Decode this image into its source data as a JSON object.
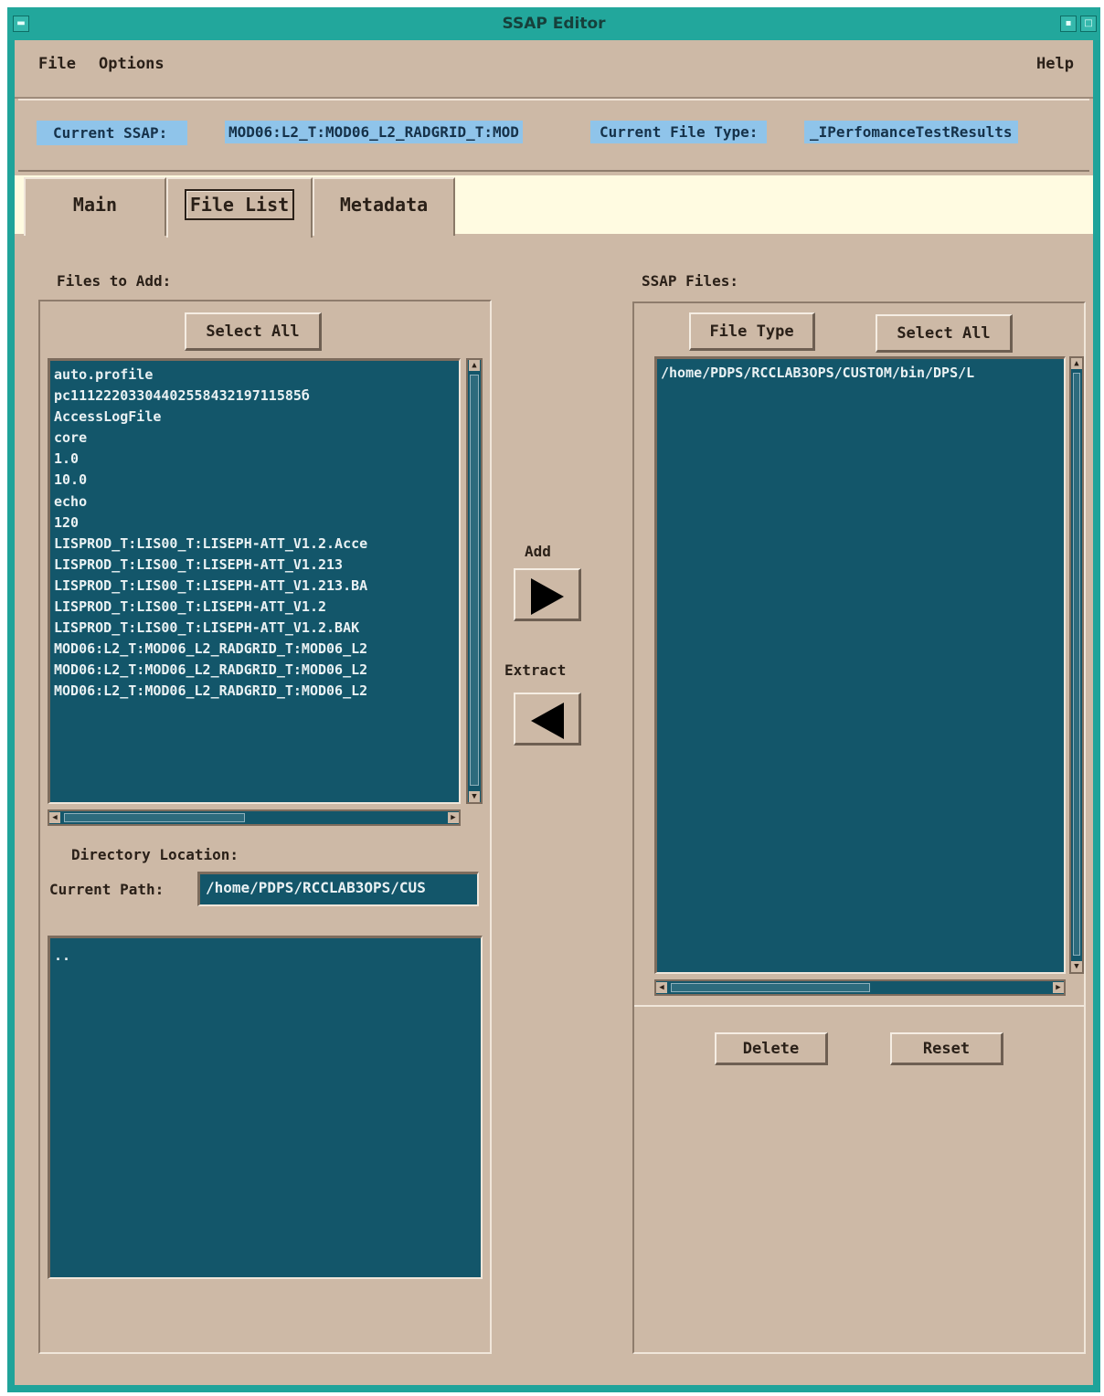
{
  "window": {
    "title": "SSAP Editor"
  },
  "menu": {
    "file": "File",
    "options": "Options",
    "help": "Help"
  },
  "ssap": {
    "current_ssap_label": "Current SSAP:",
    "current_ssap_value": "MOD06:L2_T:MOD06_L2_RADGRID_T:MOD",
    "file_type_label": "Current File Type:",
    "file_type_value": "_IPerfomanceTestResults"
  },
  "tabs": [
    {
      "label": "Main"
    },
    {
      "label": "File List"
    },
    {
      "label": "Metadata"
    }
  ],
  "left": {
    "files_to_add_label": "Files to Add:",
    "select_all": "Select All",
    "files": [
      "auto.profile",
      "pc1112220330440255843219711585б",
      "AccessLogFile",
      "core",
      "1.0",
      "10.0",
      "echo",
      "120",
      "LISPROD_T:LIS00_T:LISEPH-ATT_V1.2.Acce",
      "LISPROD_T:LIS00_T:LISEPH-ATT_V1.213",
      "LISPROD_T:LIS00_T:LISEPH-ATT_V1.213.BA",
      "LISPROD_T:LIS00_T:LISEPH-ATT_V1.2",
      "LISPROD_T:LIS00_T:LISEPH-ATT_V1.2.BAK",
      "MOD06:L2_T:MOD06_L2_RADGRID_T:MOD06_L2",
      "MOD06:L2_T:MOD06_L2_RADGRID_T:MOD06_L2",
      "MOD06:L2_T:MOD06_L2_RADGRID_T:MOD06_L2"
    ],
    "directory_location_label": "Directory Location:",
    "current_path_label": "Current Path:",
    "current_path_value": "/home/PDPS/RCCLAB3OPS/CUS",
    "dirs": [
      ".."
    ]
  },
  "middle": {
    "add_label": "Add",
    "extract_label": "Extract"
  },
  "right": {
    "ssap_files_label": "SSAP Files:",
    "file_type_button": "File Type",
    "select_all": "Select All",
    "files": [
      "/home/PDPS/RCCLAB3OPS/CUSTOM/bin/DPS/L"
    ],
    "delete": "Delete",
    "reset": "Reset"
  }
}
